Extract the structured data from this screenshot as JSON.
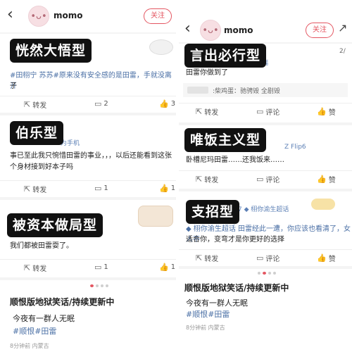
{
  "left": {
    "username": "momo",
    "follow_label": "关注",
    "card1": {
      "label": "恍然大悟型",
      "text1": "#田栩宁 苏苏#原来没有安全感的是田雷，手就没离开",
      "text2": "子",
      "repost": "转发",
      "comments": "2",
      "likes": "3"
    },
    "card2": {
      "label": "伯乐型",
      "meta": "为手机",
      "text1": "事已至此我只惋惜田雷的事业，，，以后还能看到这张",
      "text2": "个身材接到好本子吗",
      "repost": "转发",
      "comments": "1",
      "likes": "1"
    },
    "card3": {
      "label": "被资本做局型",
      "text1": "我们都被田雷耍了。",
      "repost": "转发",
      "comments": "1",
      "likes": "1"
    },
    "feed": {
      "title": "顺恨版地狱笑话/持续更新中",
      "text": "今夜有一群人无眠",
      "tags": "#顺恨#田雷",
      "time": "8分钟前 内蒙古"
    }
  },
  "right": {
    "username": "momo",
    "follow_label": "关注",
    "card1": {
      "label": "言出必行型",
      "meta": "瑞",
      "page_hint": "2/",
      "text1": "田雷你做到了",
      "reply": ":柴鸡蛋：驰骋毁 全剧毁",
      "repost": "转发",
      "comment": "评论",
      "like": "赞"
    },
    "card2": {
      "label": "唯饭主义型",
      "meta": "Z Flip6",
      "text1": "卧槽尼玛田雷……还我饭来……",
      "repost": "转发",
      "comment": "评论",
      "like": "赞"
    },
    "card3": {
      "label": "支招型",
      "meta": "7 ◆ 栩你渝生超话",
      "text1": "◆ 栩你渝生超话 田雷经此一遭，你应该也看清了，女人不",
      "text2": "适合你，变弯才是你更好的选择",
      "repost": "转发",
      "comment": "评论",
      "like": "赞"
    },
    "feed": {
      "title": "顺恨版地狱笑话/持续更新中",
      "text": "今夜有一群人无眠",
      "tags": "#顺恨#田雷",
      "time": "8分钟前 内蒙古"
    }
  },
  "icons": {
    "back": "chevron-left-icon",
    "repost": "repost-icon",
    "comment": "comment-icon",
    "like": "thumbs-up-icon",
    "share": "share-icon"
  },
  "colors": {
    "accent": "#e45661",
    "link": "#4a6fa5",
    "label_bg": "#111111"
  }
}
